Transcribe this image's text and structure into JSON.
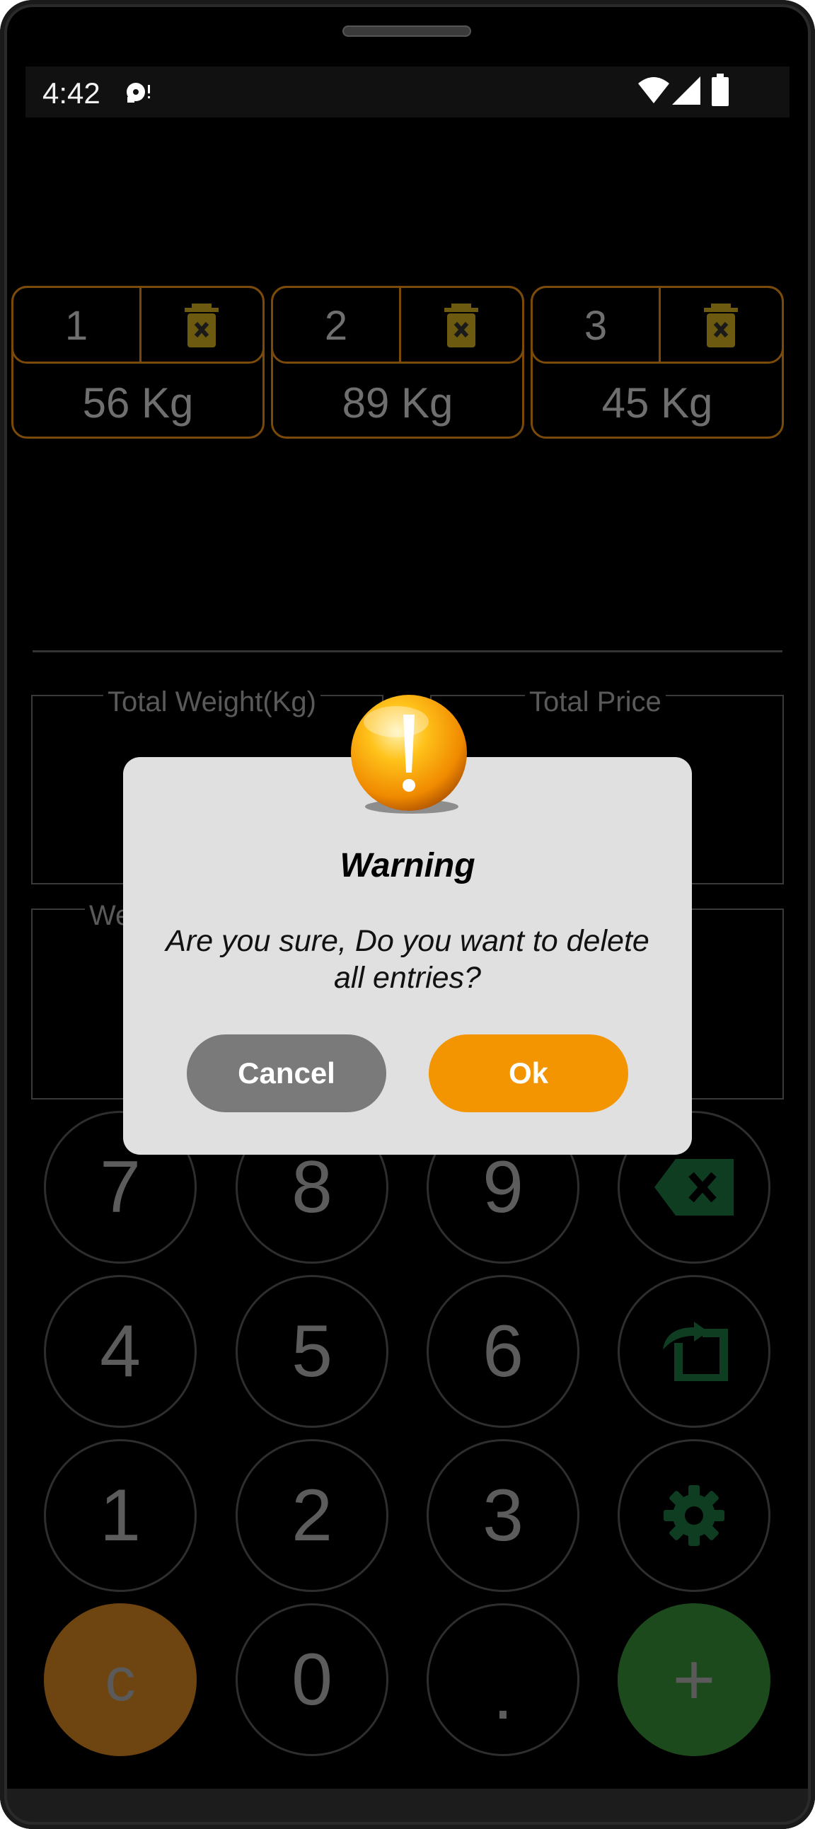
{
  "status_bar": {
    "time": "4:42",
    "icons": [
      "media-notification-icon",
      "wifi-icon",
      "signal-icon",
      "battery-icon"
    ]
  },
  "entries": [
    {
      "index": "1",
      "weight": "56 Kg"
    },
    {
      "index": "2",
      "weight": "89 Kg"
    },
    {
      "index": "3",
      "weight": "45 Kg"
    }
  ],
  "summary": {
    "total_weight_label": "Total Weight(Kg)",
    "total_price_label": "Total Price",
    "weight_partial_label": "We"
  },
  "keypad": {
    "rows": [
      [
        "7",
        "8",
        "9"
      ],
      [
        "4",
        "5",
        "6"
      ],
      [
        "1",
        "2",
        "3"
      ]
    ],
    "clear_label": "c",
    "zero_label": "0",
    "dot_label": ".",
    "add_label": "+",
    "side_icons": [
      "backspace-icon",
      "export-icon",
      "settings-icon"
    ]
  },
  "dialog": {
    "title": "Warning",
    "message": "Are you sure, Do you want to delete all entries?",
    "cancel_label": "Cancel",
    "ok_label": "Ok",
    "icon": "warning-icon"
  },
  "colors": {
    "accent_orange": "#f29500",
    "card_border": "#7a4a0a",
    "clear_key": "#6e4410",
    "add_key": "#1d4a1d",
    "cancel_button": "#7a7a7a",
    "dialog_bg": "#e0e0e0"
  }
}
